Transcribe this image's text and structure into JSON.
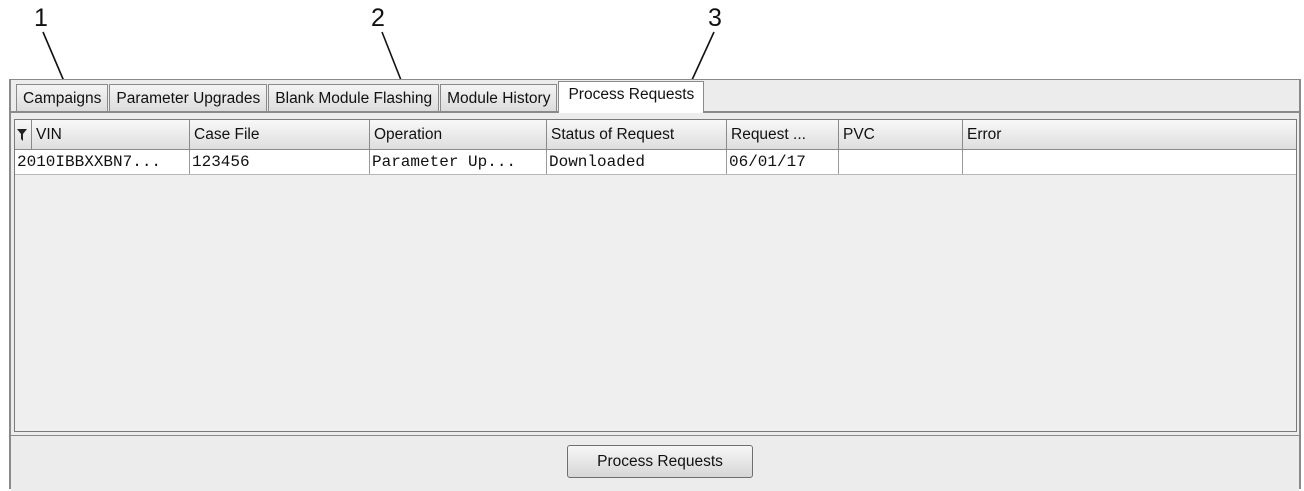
{
  "callouts": [
    "1",
    "2",
    "3"
  ],
  "tabs": [
    {
      "label": "Campaigns",
      "active": false
    },
    {
      "label": "Parameter Upgrades",
      "active": false
    },
    {
      "label": "Blank Module Flashing",
      "active": false
    },
    {
      "label": "Module History",
      "active": false
    },
    {
      "label": "Process Requests",
      "active": true
    }
  ],
  "table": {
    "columns": [
      "VIN",
      "Case File",
      "Operation",
      "Status of Request",
      "Request ...",
      "PVC",
      "Error"
    ],
    "rows": [
      [
        "2010IBBXXBN7...",
        "123456",
        "Parameter Up...",
        "Downloaded",
        "06/01/17",
        "",
        ""
      ]
    ]
  },
  "footer": {
    "process_button": "Process Requests"
  },
  "icons": {
    "filter": "filter-icon"
  }
}
